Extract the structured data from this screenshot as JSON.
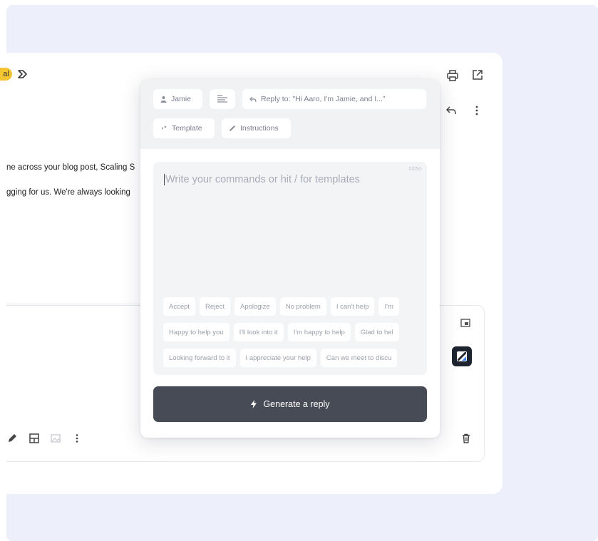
{
  "email": {
    "label_chip": "al",
    "body_lines": [
      "ne across your blog post, Scaling S",
      "gging for us. We're always looking"
    ]
  },
  "icons": {
    "label": "label-forward-icon",
    "print": "print-icon",
    "open_new": "open-in-new-icon",
    "reply": "reply-icon",
    "more": "more-vert-icon",
    "pop_out": "pop-out-icon",
    "extension": "extension-logo-icon",
    "pen": "pen-icon",
    "layout": "layout-icon",
    "image": "image-icon",
    "trash": "trash-icon"
  },
  "popup": {
    "recipient_chip": "Jamie",
    "reply_to_chip": "Reply to: \"Hi Aaro, I'm Jamie, and I...\"",
    "template_chip": "Template",
    "instructions_chip": "Instructions",
    "counter": "0/250",
    "placeholder": "Write your commands or hit / for templates",
    "quick_replies_row1": [
      "Accept",
      "Reject",
      "Apologize",
      "No problem",
      "I can't help",
      "I'm"
    ],
    "quick_replies_row2": [
      "Happy to help you",
      "I'll look into it",
      "I'm happy to help",
      "Glad to hel"
    ],
    "quick_replies_row3": [
      "Looking forward to it",
      "I appreciate your help",
      "Can we meet to discu"
    ],
    "generate_button": "Generate a reply"
  },
  "colors": {
    "page_background": "#edf0fb",
    "label_yellow": "#f5c531",
    "button_dark": "#474b55"
  }
}
